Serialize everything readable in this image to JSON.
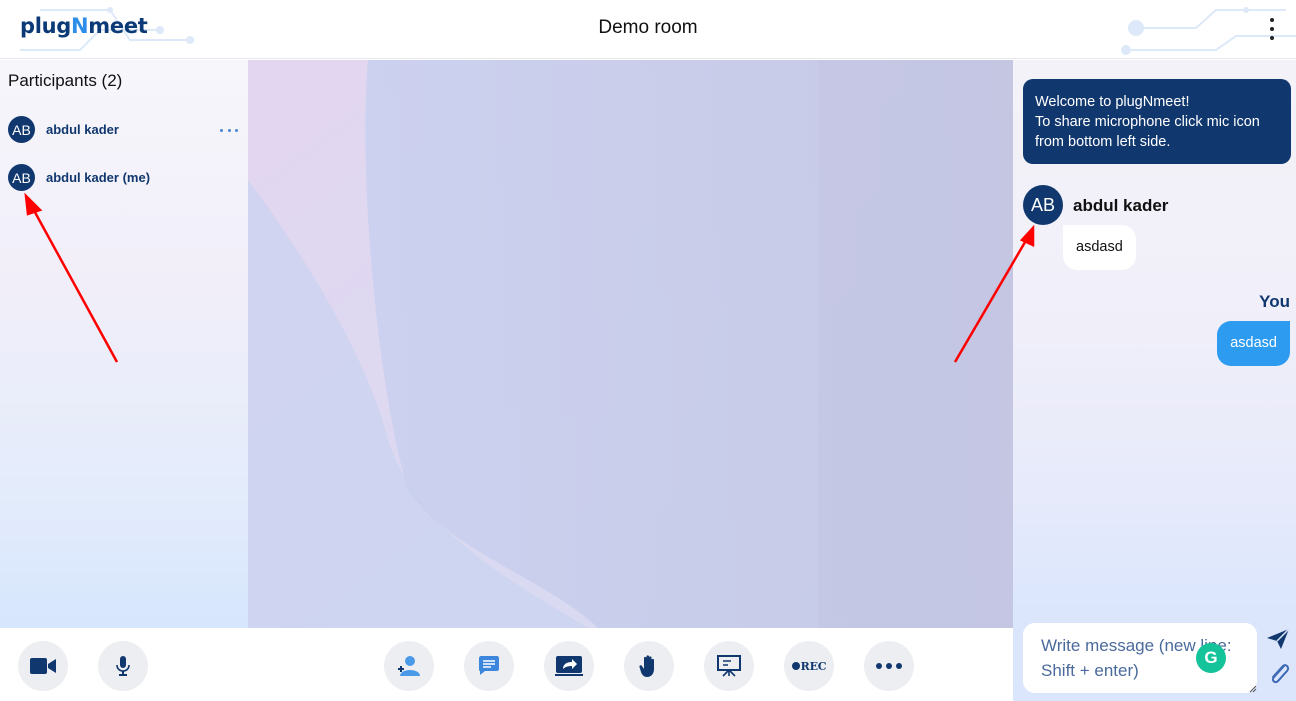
{
  "app": {
    "logo_prefix": "plug",
    "logo_accent": "N",
    "logo_suffix": "meet",
    "room_title": "Demo room",
    "menu_icon": "kebab-vertical-icon"
  },
  "participants": {
    "title": "Participants (2)",
    "items": [
      {
        "initials": "AB",
        "name": "abdul kader",
        "has_menu": true
      },
      {
        "initials": "AB",
        "name": "abdul kader (me)",
        "has_menu": false
      }
    ]
  },
  "chat": {
    "welcome_lines": [
      "Welcome to plugNmeet!",
      "To share microphone click mic icon",
      "from bottom left side."
    ],
    "messages": [
      {
        "initials": "AB",
        "author": "abdul kader",
        "text": "asdasd"
      }
    ],
    "own_label": "You",
    "own_message": "asdasd",
    "composer_placeholder": "Write message (new line: Shift + enter)",
    "grammarly_letter": "G"
  },
  "toolbar": {
    "left": [
      {
        "name": "webcam",
        "icon": "video-camera-icon"
      },
      {
        "name": "microphone",
        "icon": "microphone-icon"
      }
    ],
    "center": [
      {
        "name": "participants",
        "icon": "participants-icon"
      },
      {
        "name": "chat",
        "icon": "chat-icon"
      },
      {
        "name": "screen-share",
        "icon": "screen-share-icon"
      },
      {
        "name": "raise-hand",
        "icon": "hand-icon"
      },
      {
        "name": "whiteboard",
        "icon": "whiteboard-icon"
      },
      {
        "name": "recording",
        "icon": "record-icon",
        "label": "REC"
      },
      {
        "name": "more",
        "icon": "more-horizontal-icon"
      }
    ]
  },
  "colors": {
    "brand_dark": "#10376e",
    "brand_light": "#2d9bf0",
    "toolbar_button_bg": "#eceef1",
    "annotation_arrow": "#ff0000"
  }
}
